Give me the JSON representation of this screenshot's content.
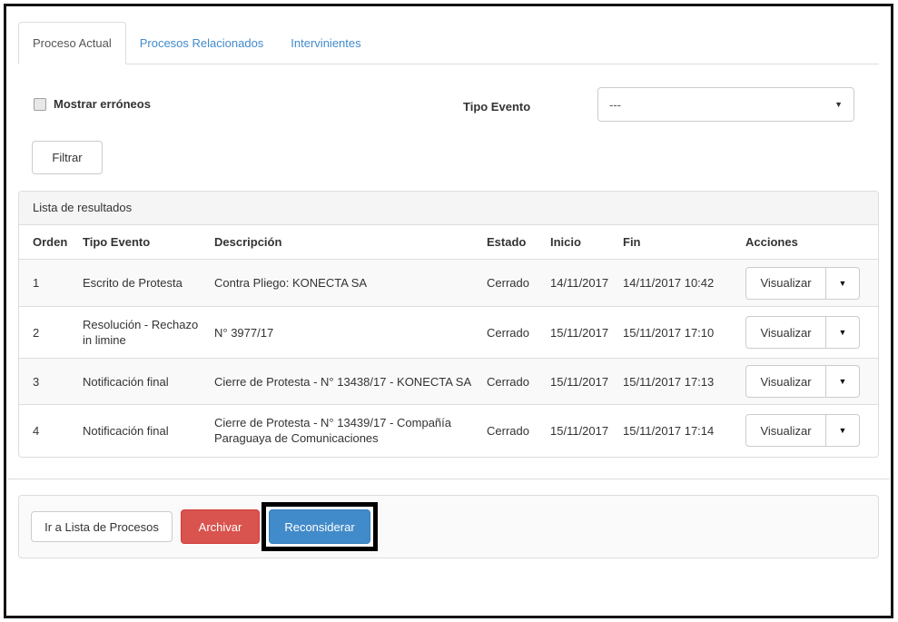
{
  "tabs": [
    {
      "label": "Proceso Actual",
      "active": true
    },
    {
      "label": "Procesos Relacionados",
      "active": false
    },
    {
      "label": "Intervinientes",
      "active": false
    }
  ],
  "filters": {
    "checkbox_label": "Mostrar erróneos",
    "checkbox_checked": false,
    "tipo_evento_label": "Tipo Evento",
    "tipo_evento_value": "---",
    "filter_button": "Filtrar"
  },
  "results": {
    "panel_title": "Lista de resultados",
    "columns": [
      "Orden",
      "Tipo Evento",
      "Descripción",
      "Estado",
      "Inicio",
      "Fin",
      "Acciones"
    ],
    "action_button": "Visualizar",
    "rows": [
      {
        "orden": "1",
        "tipo_evento": "Escrito de Protesta",
        "descripcion": "Contra Pliego: KONECTA SA",
        "estado": "Cerrado",
        "inicio": "14/11/2017",
        "fin": "14/11/2017 10:42"
      },
      {
        "orden": "2",
        "tipo_evento": "Resolución - Rechazo in limine",
        "descripcion": "N° 3977/17",
        "estado": "Cerrado",
        "inicio": "15/11/2017",
        "fin": "15/11/2017 17:10"
      },
      {
        "orden": "3",
        "tipo_evento": "Notificación final",
        "descripcion": "Cierre de Protesta - N° 13438/17 - KONECTA SA",
        "estado": "Cerrado",
        "inicio": "15/11/2017",
        "fin": "15/11/2017 17:13"
      },
      {
        "orden": "4",
        "tipo_evento": "Notificación final",
        "descripcion": "Cierre de Protesta - N° 13439/17 - Compañía Paraguaya de Comunicaciones",
        "estado": "Cerrado",
        "inicio": "15/11/2017",
        "fin": "15/11/2017 17:14"
      }
    ]
  },
  "footer": {
    "go_to_list_button": "Ir a Lista de Procesos",
    "archive_button": "Archivar",
    "reconsider_button": "Reconsiderar"
  },
  "colors": {
    "link_blue": "#428bca",
    "primary_blue": "#428bca",
    "danger_red": "#d9534f",
    "border_gray": "#dddddd",
    "panel_heading_bg": "#f5f5f5",
    "striped_row_bg": "#f9f9f9",
    "annotation_black": "#000000"
  }
}
